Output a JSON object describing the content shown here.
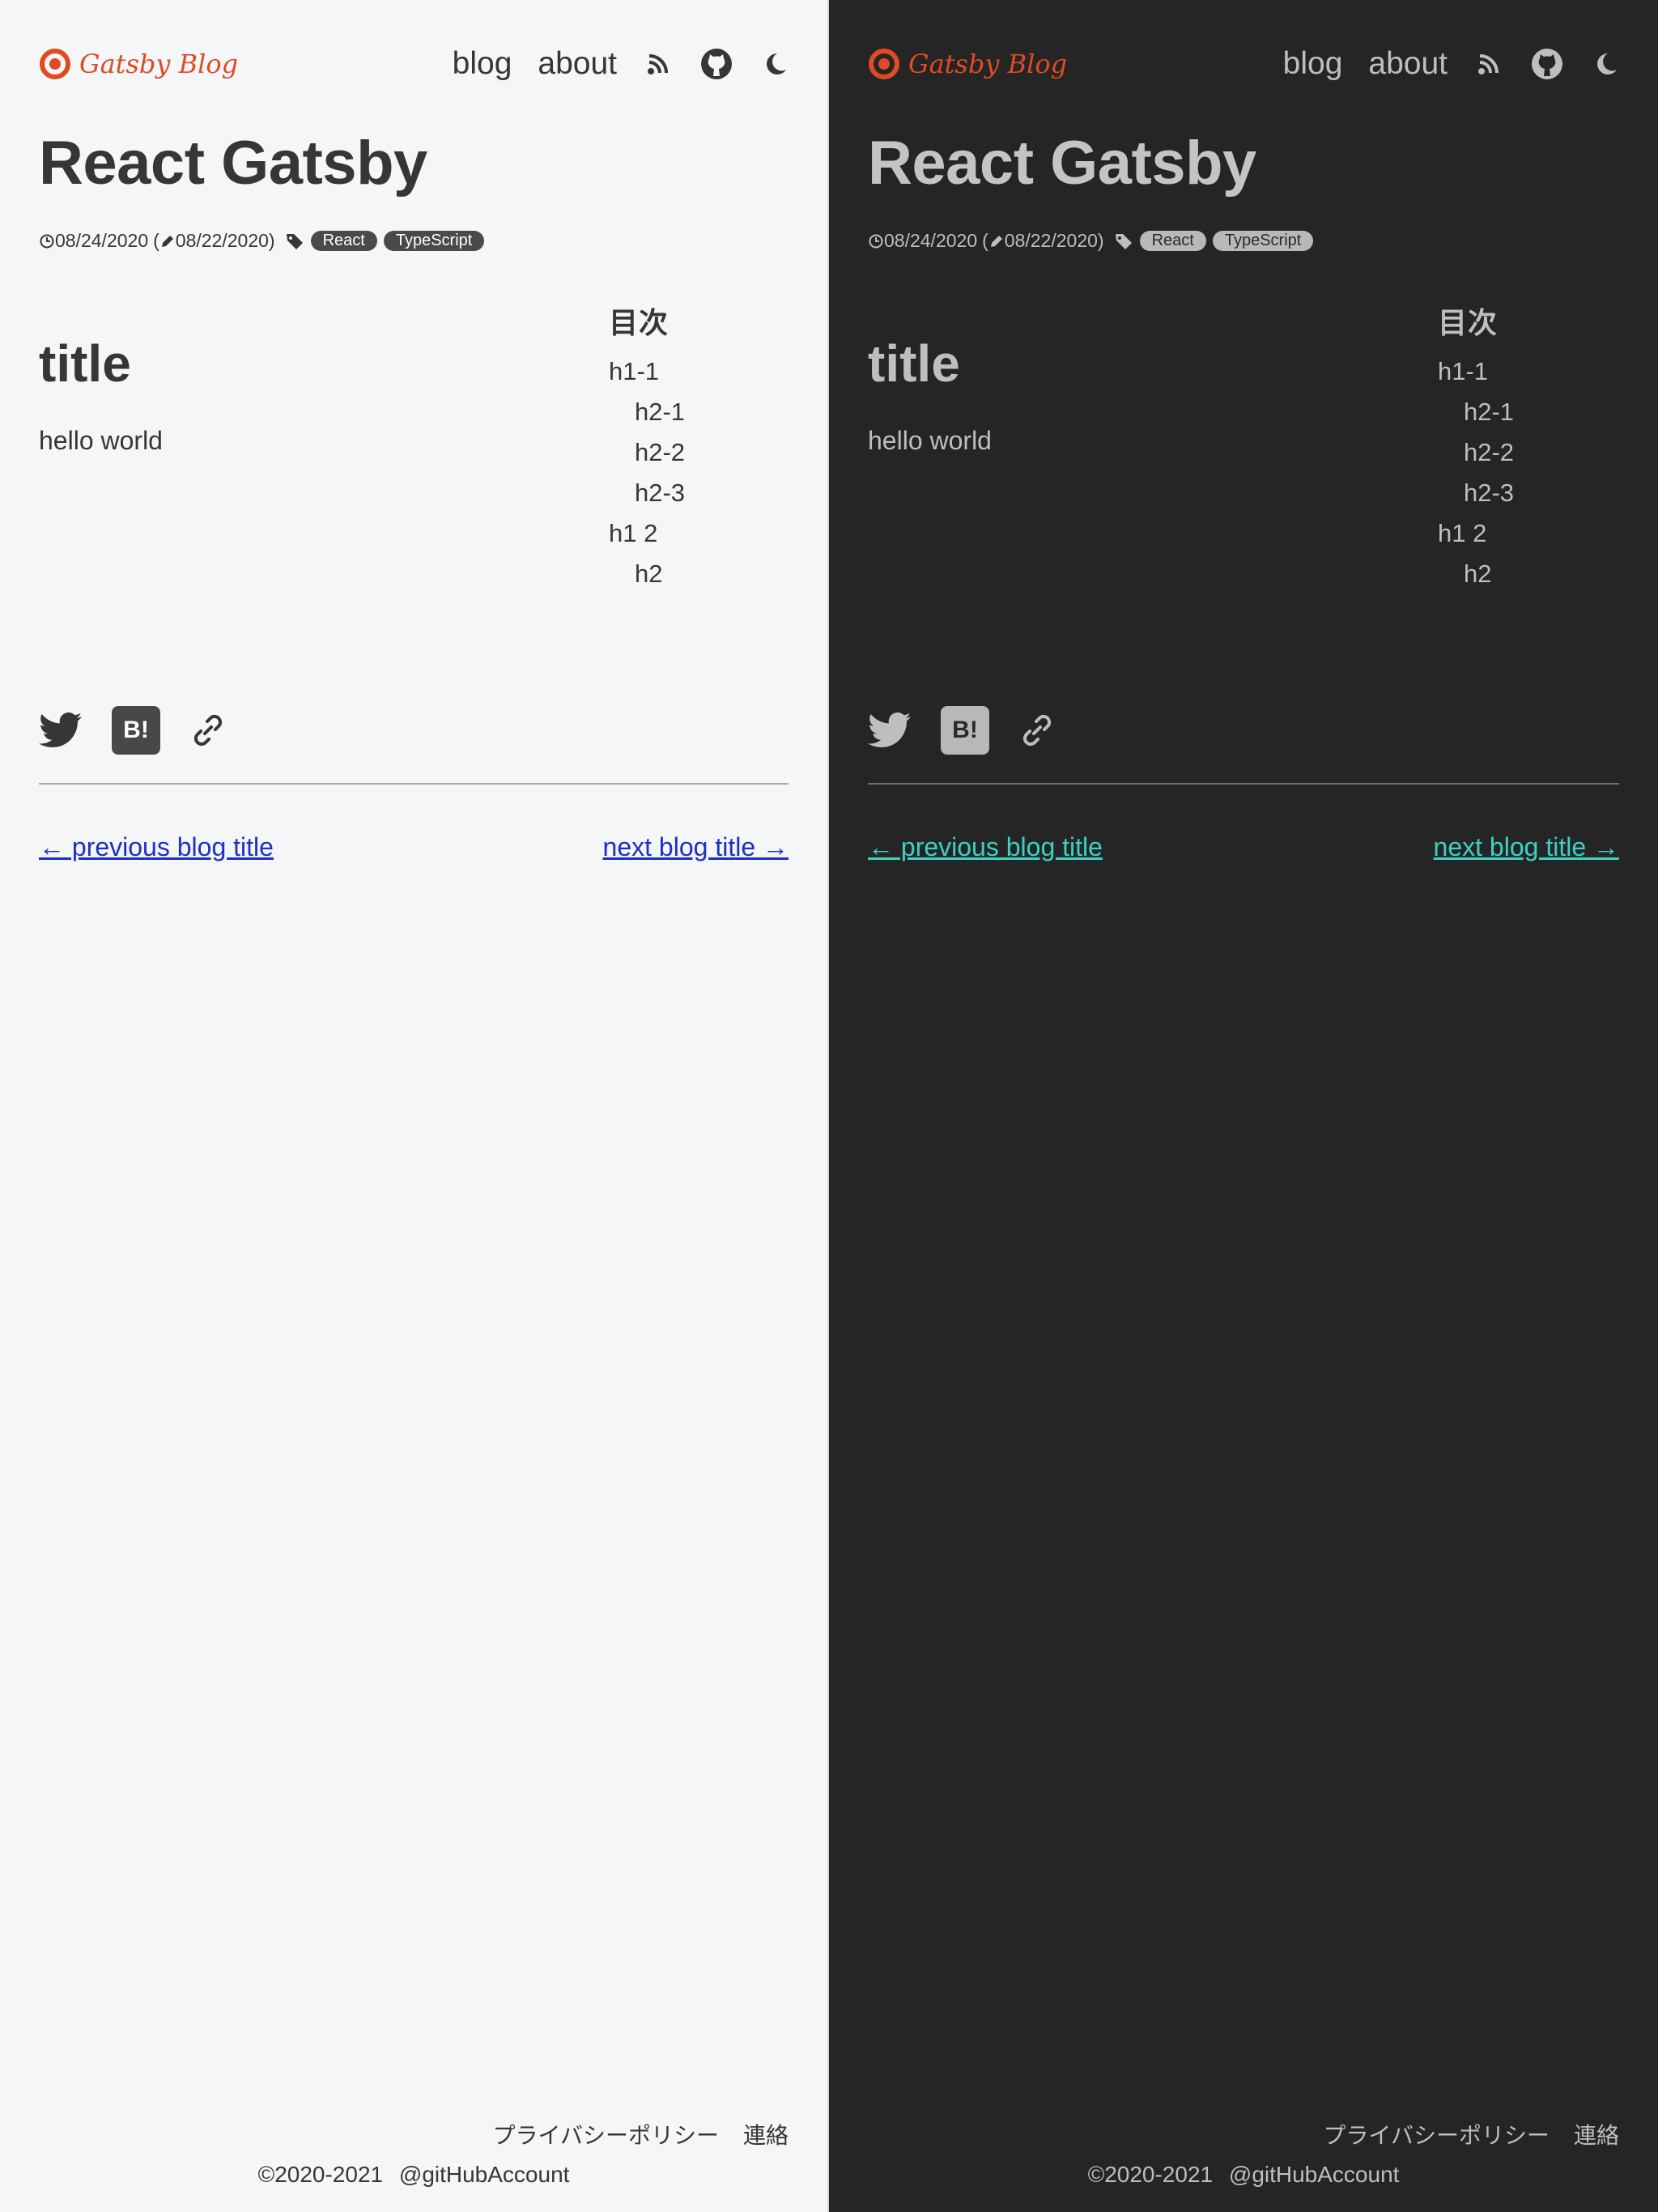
{
  "brand": {
    "name": "Gatsby Blog",
    "color": "#de4b24"
  },
  "nav": {
    "blog": "blog",
    "about": "about",
    "icons": [
      "rss-icon",
      "github-icon",
      "moon-icon"
    ]
  },
  "post": {
    "title": "React Gatsby",
    "published": "08/24/2020",
    "updated_open": "(",
    "updated": "08/22/2020)",
    "tags": [
      "React",
      "TypeScript"
    ],
    "h1": "title",
    "body": "hello world"
  },
  "toc": {
    "heading": "目次",
    "items": [
      {
        "label": "h1-1",
        "level": 1
      },
      {
        "label": "h2-1",
        "level": 2
      },
      {
        "label": "h2-2",
        "level": 2
      },
      {
        "label": "h2-3",
        "level": 2
      },
      {
        "label": "h1 2",
        "level": 1
      },
      {
        "label": "h2",
        "level": 2
      }
    ]
  },
  "share": {
    "hatena_label": "B!",
    "icons": [
      "twitter-icon",
      "hatena-bookmark-icon",
      "link-icon"
    ]
  },
  "pager": {
    "prev": "← previous blog title",
    "next": "next blog title →"
  },
  "footer": {
    "privacy": "プライバシーポリシー",
    "contact": "連絡",
    "copyright": "©2020-2021",
    "account": "@gitHubAccount"
  },
  "colors": {
    "light_bg": "#f5f6f8",
    "dark_bg": "#252525",
    "light_link": "#1c2fc8",
    "dark_link": "#3bd2c2"
  }
}
